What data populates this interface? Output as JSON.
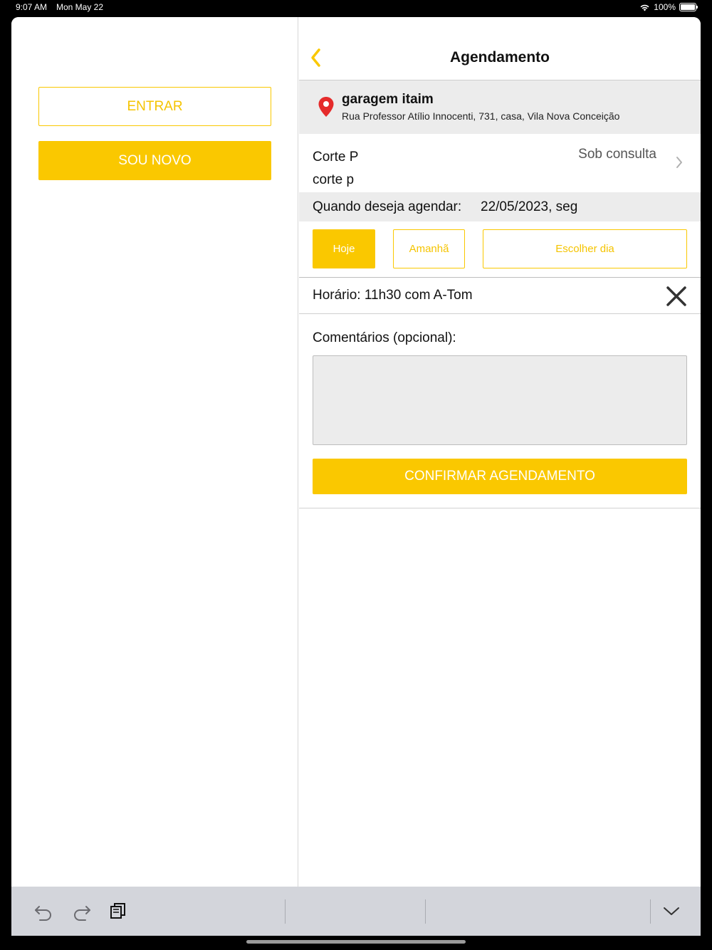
{
  "status_bar": {
    "time": "9:07 AM",
    "date": "Mon May 22",
    "battery": "100%"
  },
  "left_pane": {
    "login_button": "ENTRAR",
    "signup_button": "SOU NOVO"
  },
  "header": {
    "title": "Agendamento"
  },
  "location": {
    "name": "garagem itaim",
    "address": "Rua Professor Atílio Innocenti, 731, casa, Vila Nova Conceição"
  },
  "service": {
    "name": "Corte P",
    "description": "corte p",
    "price": "Sob consulta"
  },
  "schedule": {
    "date_label": "Quando deseja agendar:",
    "date_value": "22/05/2023, seg",
    "day_buttons": {
      "today": "Hoje",
      "tomorrow": "Amanhã",
      "choose": "Escolher dia"
    },
    "time_label": "Horário: 11h30 com A-Tom"
  },
  "comments": {
    "label": "Comentários (opcional):",
    "value": ""
  },
  "confirm_button": "CONFIRMAR AGENDAMENTO",
  "colors": {
    "accent": "#fac800",
    "pin": "#e52b2b",
    "section_bg": "#ececec"
  }
}
